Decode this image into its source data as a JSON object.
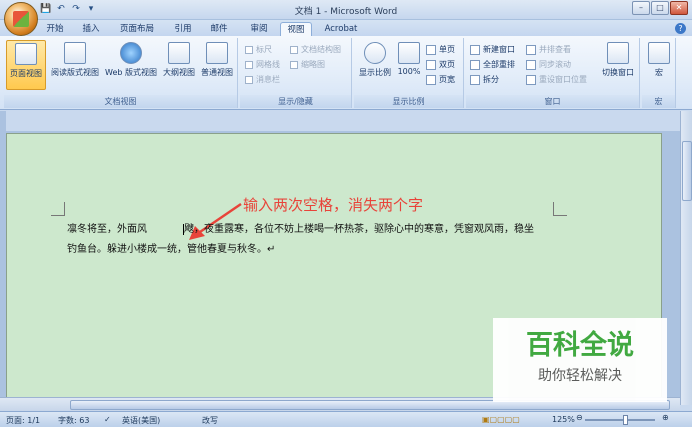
{
  "window": {
    "title": "文档 1 - Microsoft Word",
    "controls": [
      "–",
      "□",
      "✕"
    ]
  },
  "qat": [
    "💾",
    "↶",
    "↷",
    "▾"
  ],
  "tabs": [
    {
      "label": "开始"
    },
    {
      "label": "插入"
    },
    {
      "label": "页面布局"
    },
    {
      "label": "引用"
    },
    {
      "label": "邮件"
    },
    {
      "label": "审阅"
    },
    {
      "label": "视图",
      "active": true
    },
    {
      "label": "Acrobat"
    }
  ],
  "ribbon": {
    "doc_views": {
      "label": "文档视图",
      "buttons": [
        "页面视图",
        "阅读版式视图",
        "Web 版式视图",
        "大纲视图",
        "普通视图"
      ]
    },
    "show_hide": {
      "label": "显示/隐藏",
      "items": [
        "标尺",
        "网格线",
        "消息栏",
        "文档结构图",
        "缩略图"
      ]
    },
    "zoom": {
      "label": "显示比例",
      "buttons": [
        "显示比例",
        "100%"
      ],
      "small": [
        "单页",
        "双页",
        "页宽"
      ]
    },
    "window": {
      "label": "窗口",
      "small": [
        "新建窗口",
        "全部重排",
        "拆分",
        "并排查看",
        "同步滚动",
        "重设窗口位置"
      ],
      "switch": "切换窗口"
    },
    "macros": {
      "label": "宏",
      "button": "宏"
    }
  },
  "document": {
    "annotation": "输入两次空格，消失两个字",
    "line1a": "凛冬将至，外面风",
    "line1b": "飕，夜重露寒，各位不妨上楼喝一杯热茶，驱除心中的寒意，凭窗观风雨，稳坐",
    "line2": "钓鱼台。躲进小楼成一统，管他春夏与秋冬。↵"
  },
  "status": {
    "page": "页面: 1/1",
    "words": "字数: 63",
    "lang": "英语(美国)",
    "mode": "改写",
    "zoom": "125%"
  },
  "watermark": {
    "title": "百科全说",
    "sub": "助你轻松解决"
  }
}
